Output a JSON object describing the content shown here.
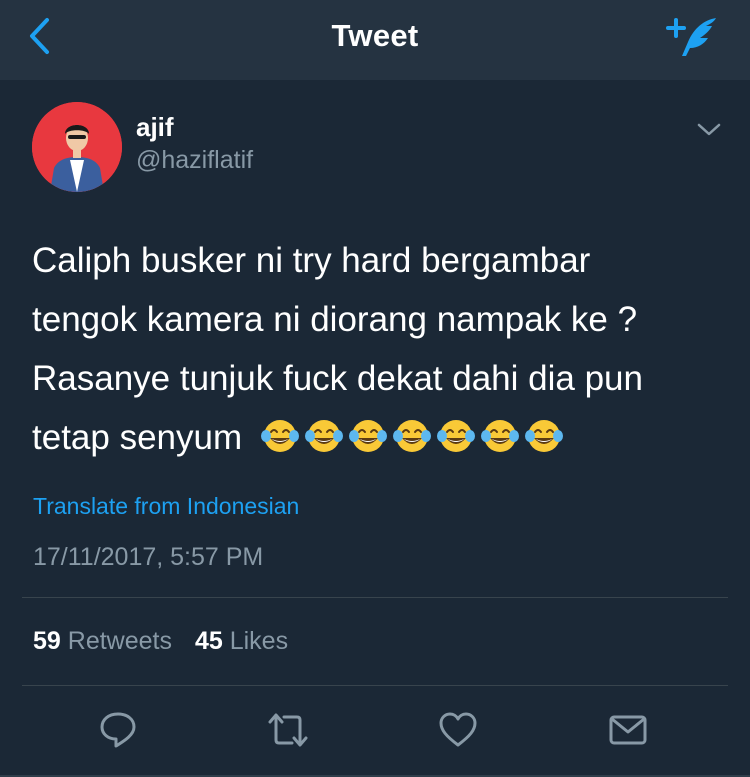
{
  "header": {
    "title": "Tweet",
    "back_icon": "chevron-left-icon",
    "compose_icon": "compose-tweet-icon",
    "accent_color": "#1da1f2"
  },
  "author": {
    "display_name": "ajif",
    "handle": "@haziflatif"
  },
  "tweet": {
    "lines": [
      "Caliph busker ni try hard bergambar",
      "tengok kamera ni diorang nampak ke ?",
      "Rasanye tunjuk fuck dekat dahi dia pun",
      "tetap senyum"
    ],
    "emoji": "face-with-tears-of-joy",
    "emoji_count": 7,
    "translate_label": "Translate from Indonesian",
    "timestamp": "17/11/2017, 5:57 PM"
  },
  "stats": {
    "retweets_count": "59",
    "retweets_label": "Retweets",
    "likes_count": "45",
    "likes_label": "Likes"
  },
  "actions": {
    "reply_icon": "reply-icon",
    "retweet_icon": "retweet-icon",
    "like_icon": "heart-icon",
    "message_icon": "envelope-icon"
  }
}
